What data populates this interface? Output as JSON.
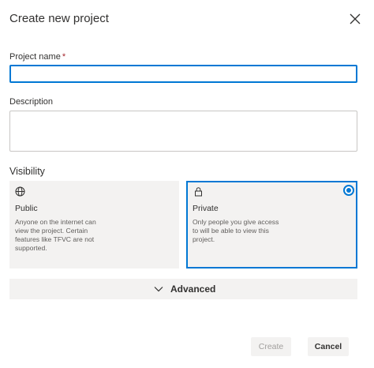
{
  "dialog": {
    "title": "Create new project"
  },
  "project_name": {
    "label": "Project name",
    "required_mark": "*",
    "value": "",
    "placeholder": ""
  },
  "description": {
    "label": "Description",
    "value": "",
    "placeholder": ""
  },
  "visibility": {
    "heading": "Visibility",
    "options": [
      {
        "icon": "globe-icon",
        "title": "Public",
        "description": "Anyone on the internet can view the project. Certain features like TFVC are not supported.",
        "selected": false
      },
      {
        "icon": "lock-icon",
        "title": "Private",
        "description": "Only people you give access to will be able to view this project.",
        "selected": true
      }
    ]
  },
  "advanced": {
    "label": "Advanced",
    "icon": "chevron-down-icon",
    "expanded": false
  },
  "footer": {
    "create_label": "Create",
    "create_enabled": false,
    "cancel_label": "Cancel"
  },
  "colors": {
    "accent": "#0078d4",
    "required": "#a4262c",
    "card_background": "#f3f2f1",
    "text_primary": "#323130",
    "text_secondary": "#605e5c",
    "text_disabled": "#a19f9d"
  }
}
